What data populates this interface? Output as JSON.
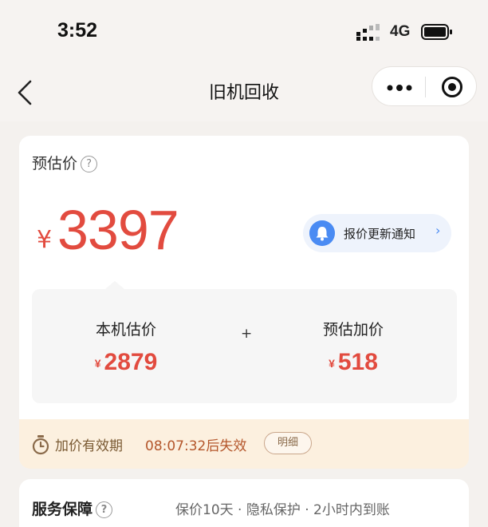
{
  "status_bar": {
    "time": "3:52",
    "network": "4G"
  },
  "nav": {
    "title": "旧机回收"
  },
  "estimate": {
    "label": "预估价",
    "currency": "¥",
    "price": "3397",
    "notify_label": "报价更新通知"
  },
  "breakdown": {
    "device_label": "本机估价",
    "device_value": "2879",
    "plus": "+",
    "bonus_label": "预估加价",
    "bonus_value": "518",
    "currency": "¥"
  },
  "validity": {
    "label": "加价有效期",
    "countdown": "08:07:32后失效",
    "detail_button": "明细"
  },
  "service": {
    "title": "服务保障",
    "description": "保价10天 · 隐私保护 · 2小时内到账"
  },
  "colors": {
    "price_red": "#e24b3f",
    "accent_blue": "#4a8bf3",
    "validity_bg": "#fcf0df"
  },
  "icons": [
    "signal-icon",
    "battery-icon",
    "back-arrow-icon",
    "more-dots-icon",
    "target-icon",
    "help-icon",
    "bell-icon",
    "chevron-right-icon",
    "timer-icon"
  ]
}
